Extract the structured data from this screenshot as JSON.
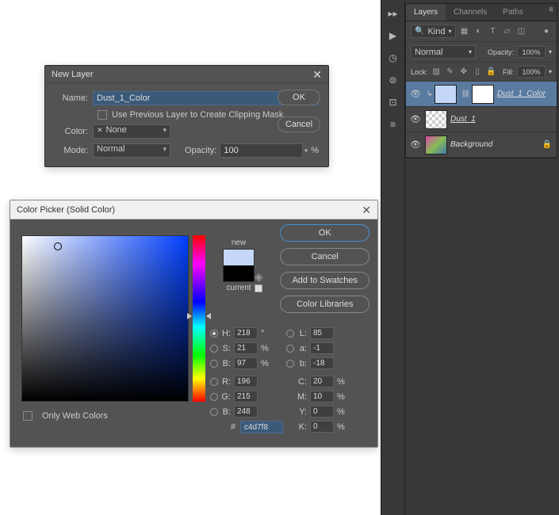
{
  "newLayer": {
    "title": "New Layer",
    "nameLabel": "Name:",
    "nameValue": "Dust_1_Color",
    "clipMask": "Use Previous Layer to Create Clipping Mask",
    "colorLabel": "Color:",
    "colorValue": "None",
    "modeLabel": "Mode:",
    "modeValue": "Normal",
    "opacityLabel": "Opacity:",
    "opacityValue": "100",
    "opacityUnit": "%",
    "ok": "OK",
    "cancel": "Cancel"
  },
  "colorPicker": {
    "title": "Color Picker (Solid Color)",
    "newLabel": "new",
    "currentLabel": "current",
    "ok": "OK",
    "cancel": "Cancel",
    "addSwatches": "Add to Swatches",
    "colorLibs": "Color Libraries",
    "onlyWeb": "Only Web Colors",
    "H": {
      "lbl": "H:",
      "v": "218",
      "u": "°"
    },
    "S": {
      "lbl": "S:",
      "v": "21",
      "u": "%"
    },
    "Bv": {
      "lbl": "B:",
      "v": "97",
      "u": "%"
    },
    "L": {
      "lbl": "L:",
      "v": "85"
    },
    "a": {
      "lbl": "a:",
      "v": "-1"
    },
    "b": {
      "lbl": "b:",
      "v": "-18"
    },
    "R": {
      "lbl": "R:",
      "v": "196"
    },
    "G": {
      "lbl": "G:",
      "v": "215"
    },
    "Bb": {
      "lbl": "B:",
      "v": "248"
    },
    "C": {
      "lbl": "C:",
      "v": "20",
      "u": "%"
    },
    "M": {
      "lbl": "M:",
      "v": "10",
      "u": "%"
    },
    "Y": {
      "lbl": "Y:",
      "v": "0",
      "u": "%"
    },
    "K": {
      "lbl": "K:",
      "v": "0",
      "u": "%"
    },
    "hash": "#",
    "hex": "c4d7f8"
  },
  "panel": {
    "tabs": {
      "layers": "Layers",
      "channels": "Channels",
      "paths": "Paths"
    },
    "kind": "Kind",
    "blend": "Normal",
    "opacityLabel": "Opacity:",
    "opacityVal": "100%",
    "lockLabel": "Lock:",
    "fillLabel": "Fill:",
    "fillVal": "100%",
    "layers": [
      {
        "name": "Dust_1_Color"
      },
      {
        "name": "Dust_1"
      },
      {
        "name": "Background"
      }
    ]
  }
}
